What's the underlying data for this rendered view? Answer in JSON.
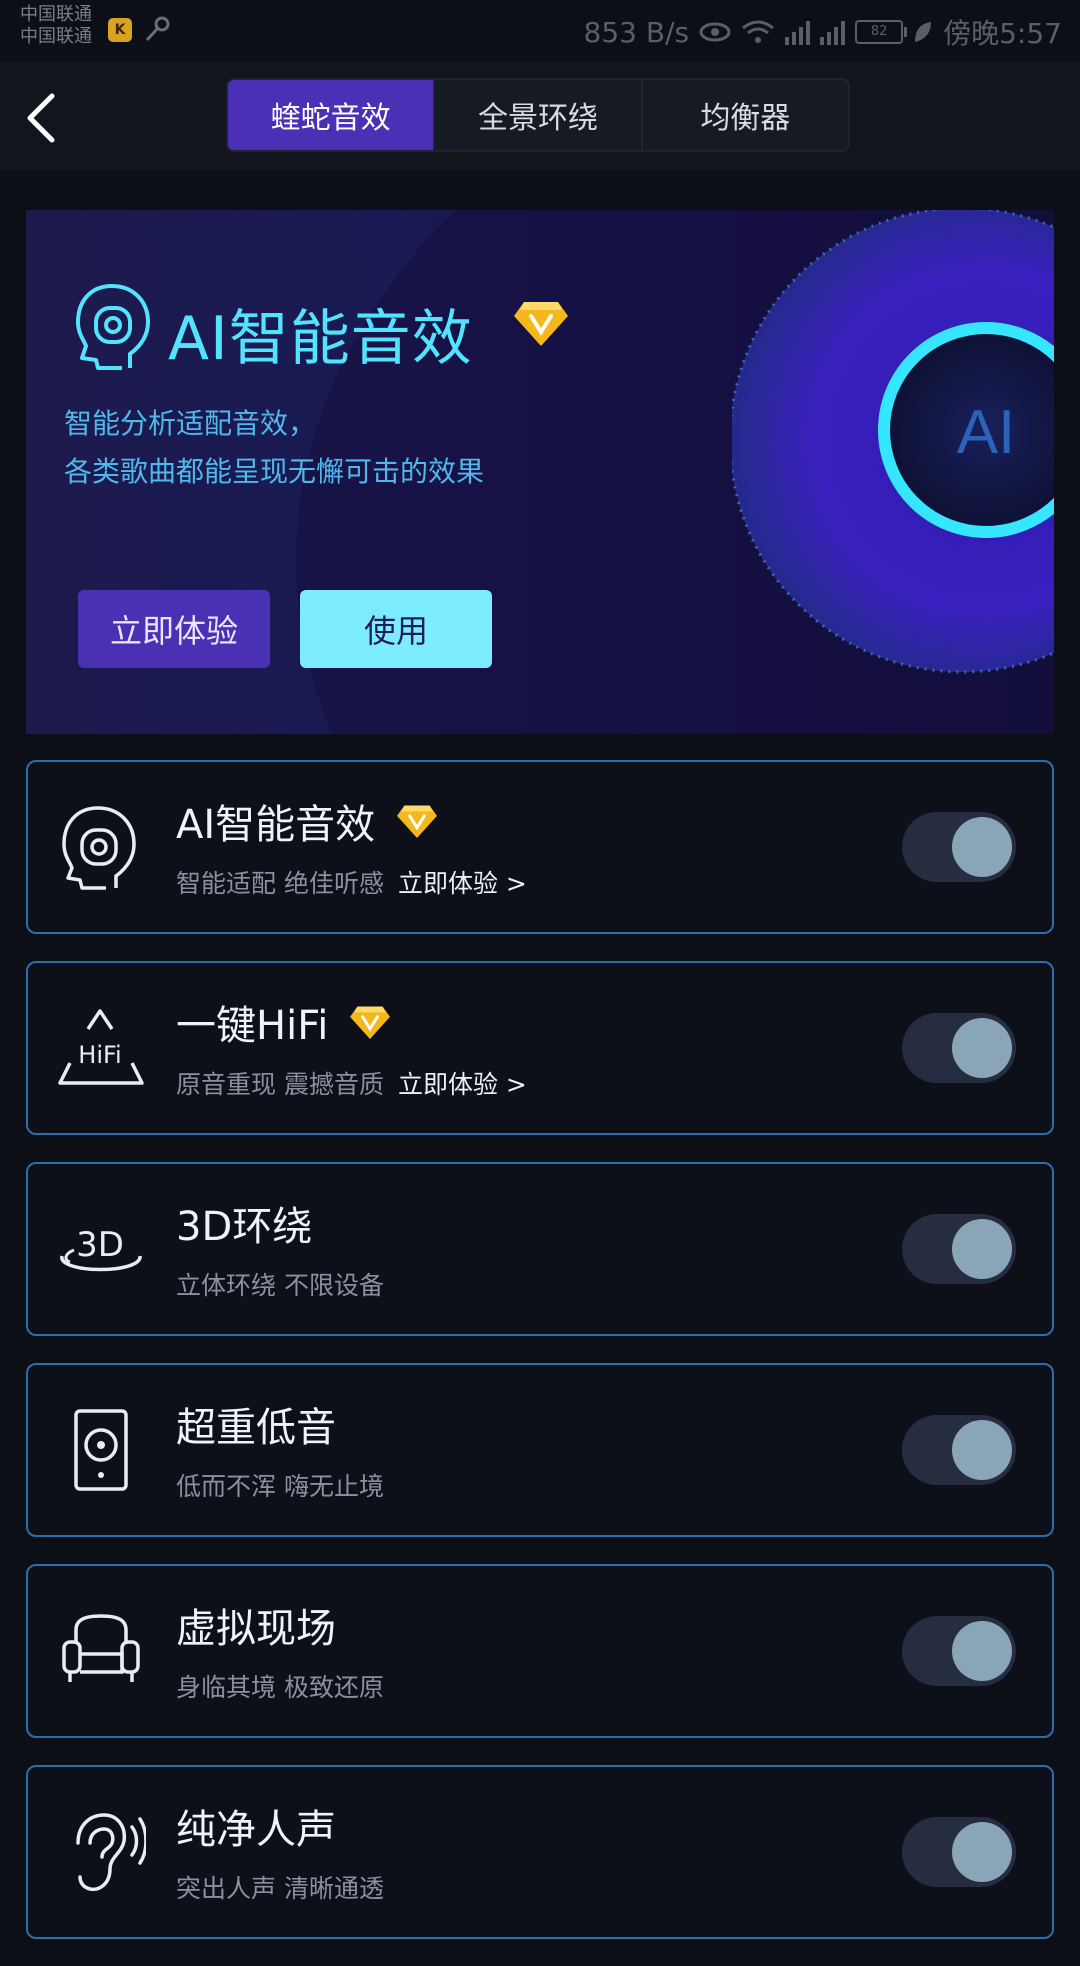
{
  "status": {
    "carrier1": "中国联通",
    "carrier2": "中国联通",
    "speed": "853 B/s",
    "battery": "82",
    "time": "傍晚5:57"
  },
  "tabs": [
    {
      "label": "蝰蛇音效",
      "active": true
    },
    {
      "label": "全景环绕",
      "active": false
    },
    {
      "label": "均衡器",
      "active": false
    }
  ],
  "banner": {
    "title": "AI智能音效",
    "desc_line1": "智能分析适配音效，",
    "desc_line2": "各类歌曲都能呈现无懈可击的效果",
    "orb_label": "AI",
    "try_label": "立即体验",
    "use_label": "使用"
  },
  "effects": [
    {
      "title": "AI智能音效",
      "subtitle": "智能适配 绝佳听感",
      "link": "立即体验 >",
      "vip": true,
      "icon": "ai-head-icon",
      "enabled": true
    },
    {
      "title": "一键HiFi",
      "subtitle": "原音重现 震撼音质",
      "link": "立即体验 >",
      "vip": true,
      "icon": "hifi-icon",
      "enabled": true
    },
    {
      "title": "3D环绕",
      "subtitle": "立体环绕 不限设备",
      "link": "",
      "vip": false,
      "icon": "3d-surround-icon",
      "enabled": true
    },
    {
      "title": "超重低音",
      "subtitle": "低而不浑 嗨无止境",
      "link": "",
      "vip": false,
      "icon": "speaker-icon",
      "enabled": true
    },
    {
      "title": "虚拟现场",
      "subtitle": "身临其境 极致还原",
      "link": "",
      "vip": false,
      "icon": "armchair-icon",
      "enabled": true
    },
    {
      "title": "纯净人声",
      "subtitle": "突出人声 清晰通透",
      "link": "",
      "vip": false,
      "icon": "ear-icon",
      "enabled": true
    }
  ],
  "icons": {
    "hifi_text": "HiFi",
    "3d_text": "3D"
  },
  "colors": {
    "accent": "#4b2fb5",
    "cyan": "#53e3ff",
    "card_border": "#2f6cae"
  }
}
